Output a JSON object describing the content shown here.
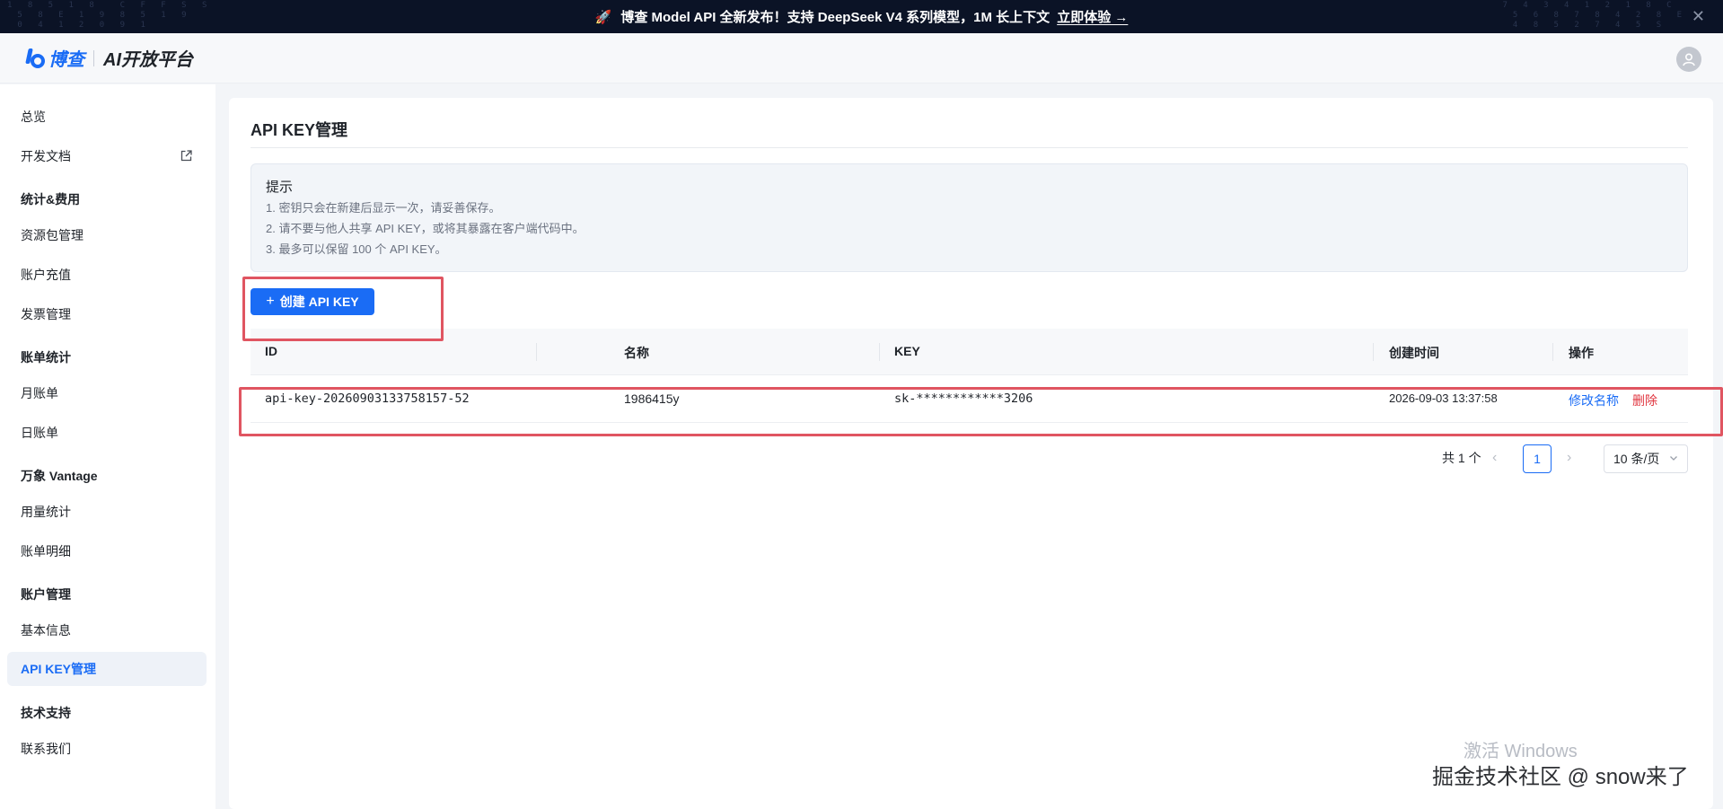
{
  "banner": {
    "matrix_left": "1 8 5 1 8  C F F S S\n 5 8 E 1 9 8 5 1 9\n 0 4 1 2 0 9 1",
    "matrix_right": "7 4 3 4 1 2 1 8 C\n 5 6 8 7 8 4 2 8 E\n 4 8 5 2 7 4 5 S",
    "rocket_icon": "rocket-icon",
    "text": "博查 Model API 全新发布！支持 DeepSeek V4 系列模型，1M 长上下文",
    "cta": "立即体验 →",
    "close_icon": "close-icon"
  },
  "header": {
    "brand": "博查",
    "title": "AI开放平台",
    "avatar_icon": "user-icon"
  },
  "sidebar": {
    "items": [
      {
        "label": "总览"
      },
      {
        "label": "开发文档",
        "icon": "external-link-icon"
      },
      {
        "group": "统计&费用"
      },
      {
        "label": "资源包管理"
      },
      {
        "label": "账户充值"
      },
      {
        "label": "发票管理"
      },
      {
        "group": "账单统计"
      },
      {
        "label": "月账单"
      },
      {
        "label": "日账单"
      },
      {
        "group": "万象 Vantage"
      },
      {
        "label": "用量统计"
      },
      {
        "label": "账单明细"
      },
      {
        "group": "账户管理"
      },
      {
        "label": "基本信息"
      },
      {
        "label": "API KEY管理",
        "active": true
      },
      {
        "group": "技术支持"
      },
      {
        "label": "联系我们"
      }
    ]
  },
  "main": {
    "title": "API KEY管理",
    "tip": {
      "title": "提示",
      "lines": [
        "1. 密钥只会在新建后显示一次，请妥善保存。",
        "2. 请不要与他人共享 API KEY，或将其暴露在客户端代码中。",
        "3. 最多可以保留 100 个 API KEY。"
      ]
    },
    "create_button": {
      "icon": "plus",
      "label": "创建 API KEY"
    },
    "table": {
      "columns": [
        "ID",
        "名称",
        "KEY",
        "创建时间",
        "操作"
      ],
      "rows": [
        {
          "id": "api-key-20260903133758157-52",
          "name": "1986415y",
          "key": "sk-************3206",
          "created": "2026-09-03 13:37:58",
          "actions": {
            "rename": "修改名称",
            "delete": "删除"
          }
        }
      ]
    },
    "pagination": {
      "total": "共 1 个",
      "prev": "‹",
      "current_page": "1",
      "next": "›",
      "page_size": "10 条/页"
    }
  },
  "overlay": {
    "watermark": "激活 Windows",
    "credit": "掘金技术社区 @ snow来了"
  },
  "colors": {
    "primary": "#1a6cf5",
    "danger": "#e0353f",
    "highlight": "#e05561",
    "banner_bg": "#0b1326"
  }
}
